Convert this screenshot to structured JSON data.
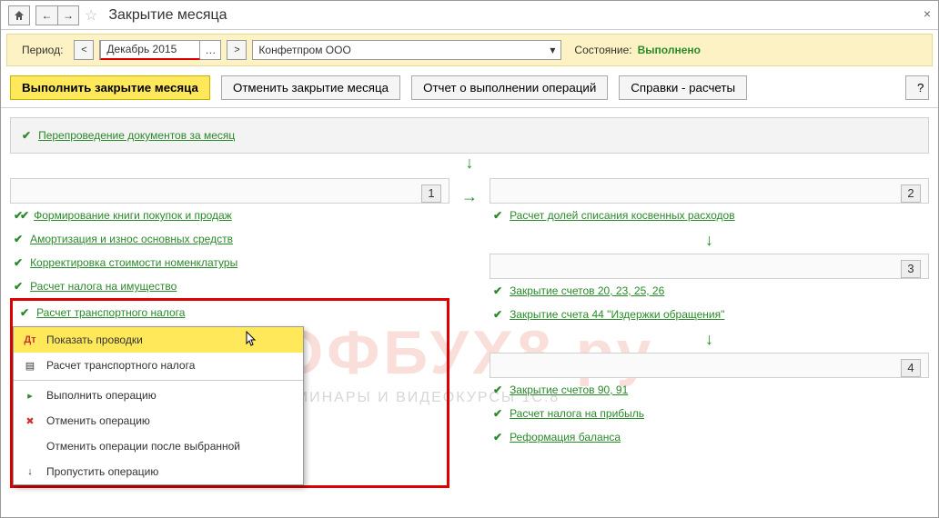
{
  "title": "Закрытие месяца",
  "period": {
    "label": "Период:",
    "value": "Декабрь 2015"
  },
  "org": {
    "value": "Конфетпром ООО"
  },
  "state": {
    "label": "Состояние:",
    "value": "Выполнено"
  },
  "toolbar": {
    "run": "Выполнить закрытие месяца",
    "cancel": "Отменить закрытие месяца",
    "report": "Отчет о выполнении операций",
    "ref": "Справки - расчеты",
    "help": "?"
  },
  "top_op": "Перепроведение документов за месяц",
  "col1": {
    "items": [
      "Формирование книги покупок и продаж",
      "Амортизация и износ основных средств",
      "Корректировка стоимости номенклатуры",
      "Расчет налога на имущество",
      "Расчет транспортного налога"
    ]
  },
  "col2": {
    "items": [
      "Расчет долей списания косвенных расходов"
    ]
  },
  "col3": {
    "items": [
      "Закрытие счетов 20, 23, 25, 26",
      "Закрытие счета 44 \"Издержки обращения\""
    ]
  },
  "col4": {
    "items": [
      "Закрытие счетов 90, 91",
      "Расчет налога на прибыль",
      "Реформация баланса"
    ]
  },
  "ctx": {
    "show_entries": "Показать проводки",
    "report": "Расчет транспортного налога",
    "run_op": "Выполнить операцию",
    "cancel_op": "Отменить операцию",
    "cancel_after": "Отменить операции после выбранной",
    "skip": "Пропустить операцию"
  },
  "nums": {
    "n1": "1",
    "n2": "2",
    "n3": "3",
    "n4": "4"
  },
  "watermark": {
    "main": "ПРОФБУХ8.ру",
    "sub": "ОНЛАЙН-СЕМИНАРЫ И ВИДЕОКУРСЫ 1С:8"
  }
}
